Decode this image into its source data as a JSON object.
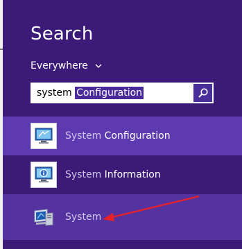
{
  "search": {
    "title": "Search",
    "scope_label": "Everywhere",
    "query_typed": "system ",
    "query_selected": "Configuration"
  },
  "results": [
    {
      "prefix": "System ",
      "rest": "Configuration",
      "icon": "system-configuration-icon"
    },
    {
      "prefix": "System ",
      "rest": "Information",
      "icon": "system-information-icon"
    },
    {
      "prefix": "System",
      "rest": "",
      "icon": "system-icon"
    }
  ],
  "colors": {
    "background": "#3c1a78",
    "highlight": "#5e3ab0",
    "search_button": "#4a2f9b",
    "selection": "#4a2a9a",
    "annotation_arrow": "#e8202a"
  }
}
